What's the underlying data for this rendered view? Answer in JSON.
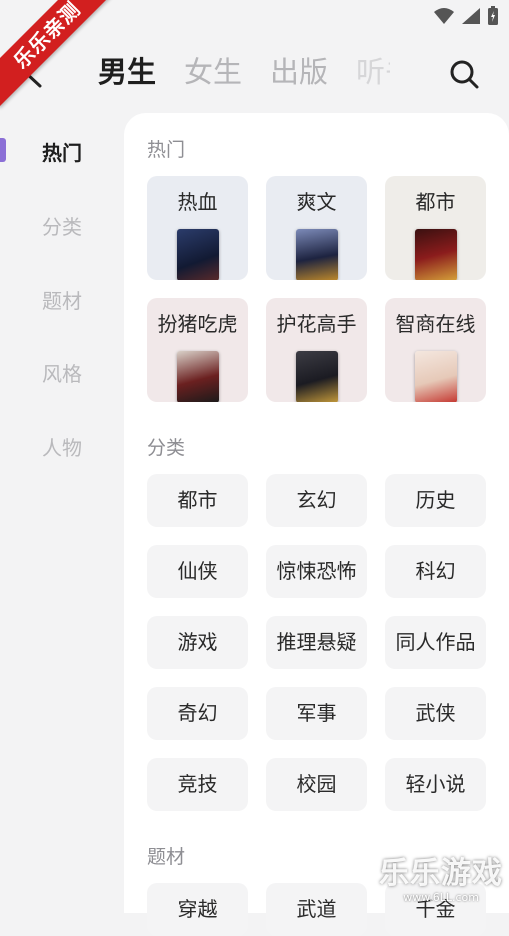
{
  "ribbon": "乐乐亲测",
  "header": {
    "tabs": [
      "男生",
      "女生",
      "出版",
      "听书"
    ]
  },
  "sidebar": {
    "items": [
      "热门",
      "分类",
      "题材",
      "风格",
      "人物"
    ],
    "active_index": 0,
    "accent": "#8b6fd6"
  },
  "sections": {
    "hot_title": "热门",
    "hot_cards": [
      {
        "label": "热血",
        "bg": "#e9ecf2"
      },
      {
        "label": "爽文",
        "bg": "#e9ecf2"
      },
      {
        "label": "都市",
        "bg": "#efede9"
      },
      {
        "label": "扮猪吃虎",
        "bg": "#f1e8e9"
      },
      {
        "label": "护花高手",
        "bg": "#f1e8e9"
      },
      {
        "label": "智商在线",
        "bg": "#f1e8e9"
      }
    ],
    "category_title": "分类",
    "categories": [
      "都市",
      "玄幻",
      "历史",
      "仙侠",
      "惊悚恐怖",
      "科幻",
      "游戏",
      "推理悬疑",
      "同人作品",
      "奇幻",
      "军事",
      "武侠",
      "竞技",
      "校园",
      "轻小说"
    ],
    "theme_title": "题材",
    "themes_partial": [
      "穿越",
      "武道",
      "千金"
    ]
  },
  "watermark": {
    "main": "乐乐游戏",
    "sub": "www.6LL.com"
  }
}
